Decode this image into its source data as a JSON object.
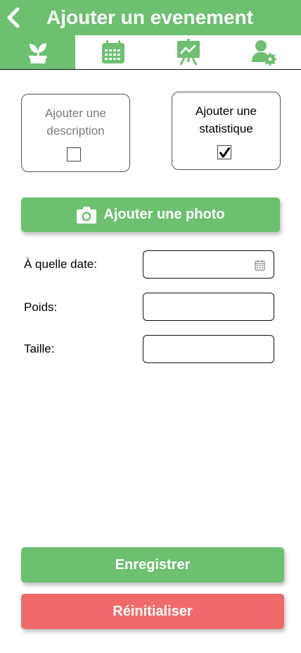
{
  "header": {
    "title": "Ajouter un evenement",
    "back_icon": "chevron-left-icon"
  },
  "tabs": [
    {
      "icon": "plant-icon",
      "active": true
    },
    {
      "icon": "calendar-icon",
      "active": false
    },
    {
      "icon": "chart-presentation-icon",
      "active": false
    },
    {
      "icon": "user-settings-icon",
      "active": false
    }
  ],
  "options": {
    "description": {
      "label": "Ajouter une description",
      "checked": false
    },
    "statistic": {
      "label": "Ajouter une statistique",
      "checked": true
    }
  },
  "photo_button": {
    "label": "Ajouter une photo",
    "icon": "camera-icon"
  },
  "form": {
    "date_label": "À quelle date:",
    "weight_label": "Poids:",
    "height_label": "Taille:"
  },
  "actions": {
    "save_label": "Enregistrer",
    "reset_label": "Réinitialiser"
  },
  "colors": {
    "primary": "#6cc070",
    "danger": "#f06a6a"
  }
}
